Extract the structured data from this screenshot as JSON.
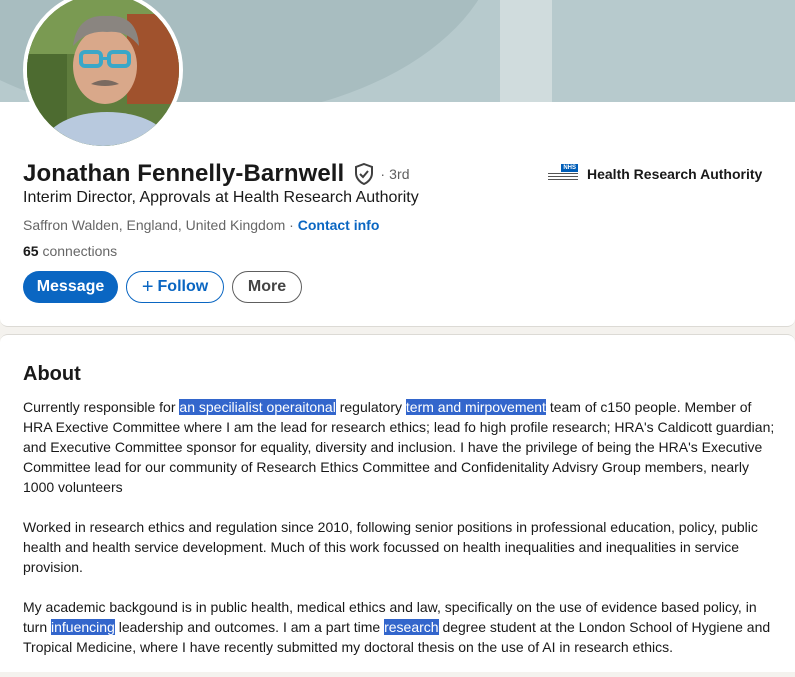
{
  "profile": {
    "name": "Jonathan Fennelly-Barnwell",
    "degree": "· 3rd",
    "headline": "Interim Director, Approvals at Health Research Authority",
    "location": "Saffron Walden, England, United Kingdom",
    "separator": " · ",
    "contact_label": "Contact info",
    "connections_count": "65",
    "connections_label": " connections",
    "organization": "Health Research Authority",
    "org_logo_badge": "NHS",
    "verified_icon": "shield-check-icon"
  },
  "actions": {
    "message": "Message",
    "follow": "Follow",
    "follow_icon": "+",
    "more": "More"
  },
  "about": {
    "title": "About",
    "p1": [
      {
        "text": "Currently responsible for ",
        "hl": false
      },
      {
        "text": "an specilialist operaitonal",
        "hl": true
      },
      {
        "text": " regulatory ",
        "hl": false
      },
      {
        "text": "term and mirpovement",
        "hl": true
      },
      {
        "text": " team of c150 people. Member of HRA Exective Committee where I am the lead for research ethics; lead fo high profile research; HRA's Caldicott guardian; and Executive Committee sponsor for equality, diversity and inclusion. I have the privilege of being the HRA's Executive Committee lead for our community of Research Ethics Committee and Confidenitality Advisry Group members, nearly 1000 volunteers",
        "hl": false
      }
    ],
    "p2": [
      {
        "text": "Worked in research ethics and regulation since 2010, following senior positions in professional education, policy, public health and health service development. Much of this work focussed on health inequalities and inequalities in service provision.",
        "hl": false
      }
    ],
    "p3": [
      {
        "text": "My academic backgound is in public health, medical ethics and law, specifically on the use of evidence based policy, in turn ",
        "hl": false
      },
      {
        "text": "infuencing",
        "hl": true
      },
      {
        "text": " leadership and outcomes. I am a part time ",
        "hl": false
      },
      {
        "text": "research",
        "hl": true
      },
      {
        "text": " degree student at the London School of Hygiene and Tropical Medicine, where I have recently submitted my doctoral thesis on the use of AI in research ethics.",
        "hl": false
      }
    ]
  },
  "colors": {
    "primary": "#0a66c2",
    "highlight": "#3366cc",
    "banner": "#b7cacd"
  }
}
